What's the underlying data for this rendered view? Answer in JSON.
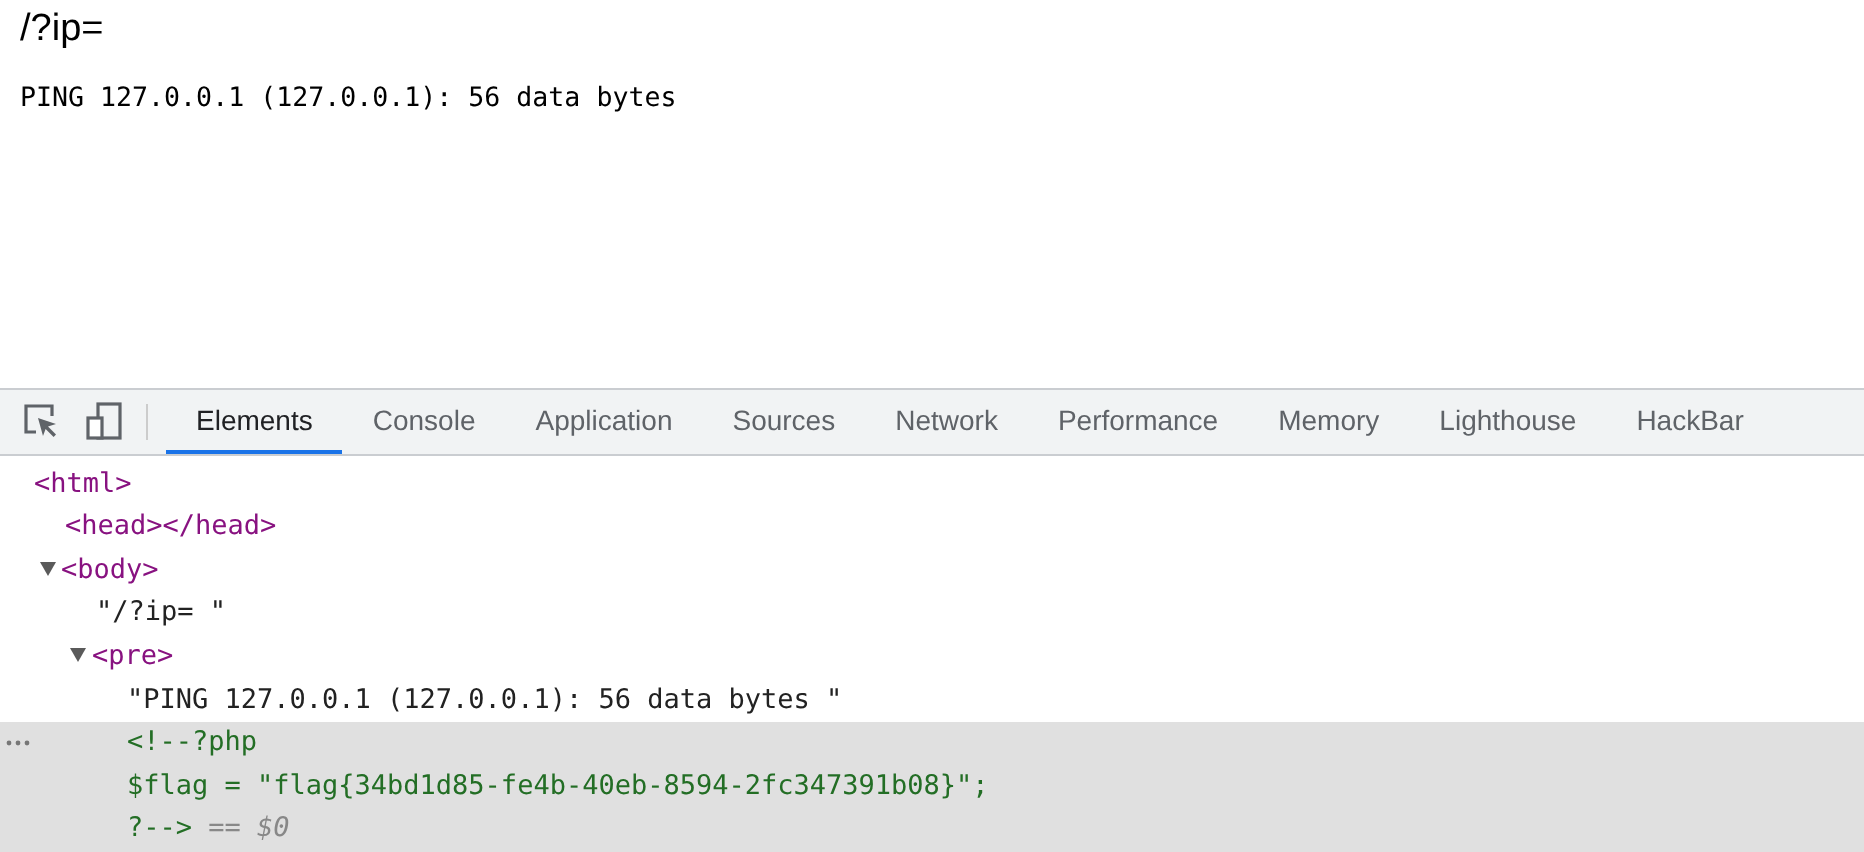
{
  "page": {
    "heading": "/?ip=",
    "output": "PING 127.0.0.1 (127.0.0.1): 56 data bytes"
  },
  "devtools": {
    "tabs": [
      {
        "label": "Elements",
        "selected": true
      },
      {
        "label": "Console",
        "selected": false
      },
      {
        "label": "Application",
        "selected": false
      },
      {
        "label": "Sources",
        "selected": false
      },
      {
        "label": "Network",
        "selected": false
      },
      {
        "label": "Performance",
        "selected": false
      },
      {
        "label": "Memory",
        "selected": false
      },
      {
        "label": "Lighthouse",
        "selected": false
      },
      {
        "label": "HackBar",
        "selected": false
      }
    ],
    "dom_tree": [
      {
        "kind": "tag",
        "lines": [
          "<html>"
        ],
        "expanded": false,
        "selected": false,
        "children": [
          {
            "kind": "tag",
            "lines": [
              "<head></head>"
            ],
            "expanded": false,
            "selected": false
          },
          {
            "kind": "tag",
            "lines": [
              "<body>"
            ],
            "expanded": true,
            "selected": false,
            "children": [
              {
                "kind": "text",
                "lines": [
                  "\"/?ip= \""
                ],
                "expanded": false,
                "selected": false
              },
              {
                "kind": "tag",
                "lines": [
                  "<pre>"
                ],
                "expanded": true,
                "selected": false,
                "children": [
                  {
                    "kind": "text",
                    "lines": [
                      "\"PING 127.0.0.1 (127.0.0.1): 56 data bytes \""
                    ],
                    "expanded": false,
                    "selected": false
                  },
                  {
                    "kind": "comment",
                    "lines": [
                      "<!--?php",
                      "$flag = \"flag{34bd1d85-fe4b-40eb-8594-2fc347391b08}\";",
                      "?-->"
                    ],
                    "expanded": false,
                    "selected": true,
                    "ref": "== $0"
                  }
                ]
              }
            ]
          }
        ]
      }
    ]
  }
}
